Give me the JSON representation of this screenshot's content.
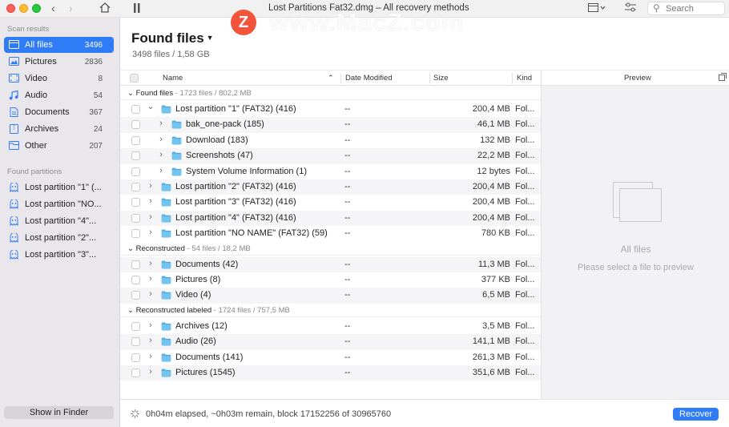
{
  "window": {
    "title": "Lost Partitions Fat32.dmg – All recovery methods",
    "search_placeholder": "Search",
    "watermark": "www.MacZ.com",
    "watermark_logo": "Z"
  },
  "sidebar": {
    "scan_results_heading": "Scan results",
    "scan_results": [
      {
        "label": "All files",
        "count": "3496",
        "icon": "all-files-icon",
        "selected": true
      },
      {
        "label": "Pictures",
        "count": "2836",
        "icon": "pictures-icon"
      },
      {
        "label": "Video",
        "count": "8",
        "icon": "video-icon"
      },
      {
        "label": "Audio",
        "count": "54",
        "icon": "audio-icon"
      },
      {
        "label": "Documents",
        "count": "367",
        "icon": "documents-icon"
      },
      {
        "label": "Archives",
        "count": "24",
        "icon": "archives-icon"
      },
      {
        "label": "Other",
        "count": "207",
        "icon": "other-icon"
      }
    ],
    "found_partitions_heading": "Found partitions",
    "partitions": [
      {
        "label": "Lost partition \"1\" (..."
      },
      {
        "label": "Lost partition \"NO..."
      },
      {
        "label": "Lost partition \"4\"..."
      },
      {
        "label": "Lost partition \"2\"..."
      },
      {
        "label": "Lost partition \"3\"..."
      }
    ],
    "show_in_finder": "Show in Finder"
  },
  "main": {
    "title": "Found files",
    "subtitle": "3498 files / 1,58 GB",
    "columns": {
      "name": "Name",
      "date": "Date Modified",
      "size": "Size",
      "kind": "Kind"
    },
    "groups": [
      {
        "label": "Found files",
        "info": " - 1723 files / 802,2 MB"
      },
      {
        "label": "Reconstructed",
        "info": " - 54 files / 18,2 MB"
      },
      {
        "label": "Reconstructed labeled",
        "info": " - 1724 files / 757,5 MB"
      }
    ],
    "rows": [
      {
        "name": "Lost partition \"1\" (FAT32) (416)",
        "date": "--",
        "size": "200,4 MB",
        "kind": "Fol...",
        "expanded": true
      },
      {
        "name": "bak_one-pack (185)",
        "date": "--",
        "size": "46,1 MB",
        "kind": "Fol..."
      },
      {
        "name": "Download (183)",
        "date": "--",
        "size": "132 MB",
        "kind": "Fol..."
      },
      {
        "name": "Screenshots (47)",
        "date": "--",
        "size": "22,2 MB",
        "kind": "Fol..."
      },
      {
        "name": "System Volume Information (1)",
        "date": "--",
        "size": "12 bytes",
        "kind": "Fol..."
      },
      {
        "name": "Lost partition \"2\" (FAT32) (416)",
        "date": "--",
        "size": "200,4 MB",
        "kind": "Fol..."
      },
      {
        "name": "Lost partition \"3\" (FAT32) (416)",
        "date": "--",
        "size": "200,4 MB",
        "kind": "Fol..."
      },
      {
        "name": "Lost partition \"4\" (FAT32) (416)",
        "date": "--",
        "size": "200,4 MB",
        "kind": "Fol..."
      },
      {
        "name": "Lost partition \"NO NAME\" (FAT32) (59)",
        "date": "--",
        "size": "780 KB",
        "kind": "Fol..."
      },
      {
        "name": "Documents (42)",
        "date": "--",
        "size": "11,3 MB",
        "kind": "Fol..."
      },
      {
        "name": "Pictures (8)",
        "date": "--",
        "size": "377 KB",
        "kind": "Fol..."
      },
      {
        "name": "Video (4)",
        "date": "--",
        "size": "6,5 MB",
        "kind": "Fol..."
      },
      {
        "name": "Archives (12)",
        "date": "--",
        "size": "3,5 MB",
        "kind": "Fol..."
      },
      {
        "name": "Audio (26)",
        "date": "--",
        "size": "141,1 MB",
        "kind": "Fol..."
      },
      {
        "name": "Documents (141)",
        "date": "--",
        "size": "261,3 MB",
        "kind": "Fol..."
      },
      {
        "name": "Pictures (1545)",
        "date": "--",
        "size": "351,6 MB",
        "kind": "Fol..."
      }
    ]
  },
  "preview": {
    "header": "Preview",
    "title": "All files",
    "subtitle": "Please select a file to preview"
  },
  "status": {
    "text": "0h04m elapsed, ~0h03m remain, block 17152256 of 30965760",
    "recover_label": "Recover"
  },
  "colors": {
    "accent": "#2f7cf6",
    "folder": "#5fb6e8",
    "sidebar_bg": "#e9e7ec"
  }
}
